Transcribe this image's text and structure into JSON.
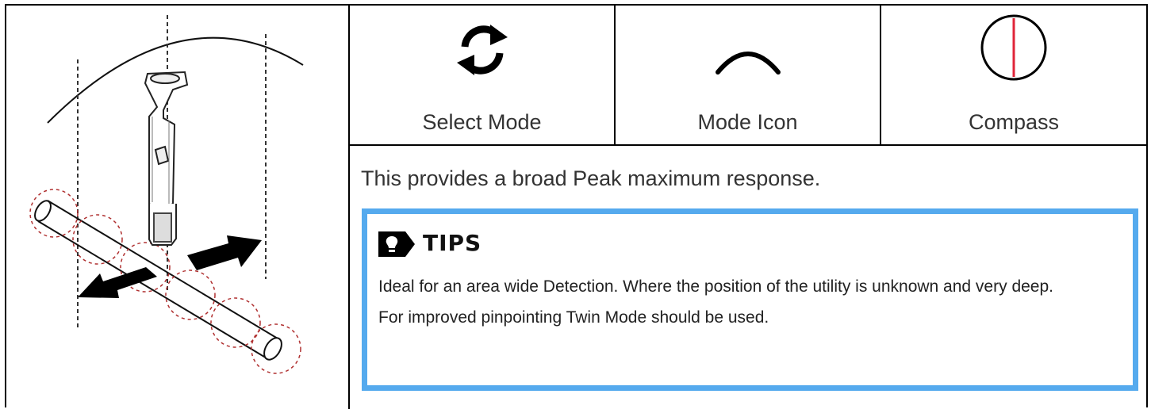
{
  "icons": [
    {
      "label": "Select Mode",
      "icon": "refresh-cycle-icon"
    },
    {
      "label": "Mode Icon",
      "icon": "arc-peak-icon"
    },
    {
      "label": "Compass",
      "icon": "compass-needle-icon"
    }
  ],
  "description": "This provides a broad Peak maximum response.",
  "tips": {
    "title": "TIPS",
    "icon": "lightbulb-icon",
    "lines": [
      "Ideal for an area wide Detection. Where the position of the utility is unknown and very deep.",
      "For improved pinpointing Twin Mode should be used."
    ]
  },
  "colors": {
    "tips_border": "#55aaee",
    "compass_needle": "#e0243a"
  }
}
